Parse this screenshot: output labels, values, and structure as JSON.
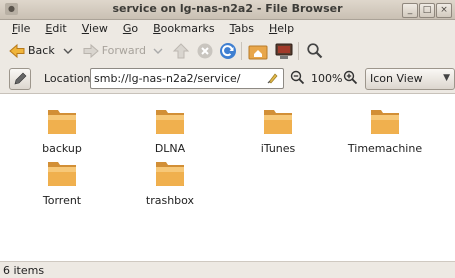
{
  "window": {
    "title": "service on lg-nas-n2a2 - File Browser",
    "controls": [
      "_",
      "□",
      "×"
    ]
  },
  "menu": [
    {
      "label": "File",
      "mnemonic": "F",
      "rest": "ile"
    },
    {
      "label": "Edit",
      "mnemonic": "E",
      "rest": "dit"
    },
    {
      "label": "View",
      "mnemonic": "V",
      "rest": "iew"
    },
    {
      "label": "Go",
      "mnemonic": "G",
      "rest": "o"
    },
    {
      "label": "Bookmarks",
      "mnemonic": "B",
      "rest": "ookmarks"
    },
    {
      "label": "Tabs",
      "mnemonic": "T",
      "rest": "abs"
    },
    {
      "label": "Help",
      "mnemonic": "H",
      "rest": "elp"
    }
  ],
  "toolbar": {
    "back_label": "Back",
    "forward_label": "Forward",
    "icons": [
      "back-arrow-icon",
      "forward-arrow-icon",
      "home-icon",
      "stop-icon",
      "reload-icon",
      "home-folder-icon",
      "computer-icon",
      "search-icon"
    ]
  },
  "location": {
    "label": "Location:",
    "value": "smb://lg-nas-n2a2/service/",
    "zoom": "100%",
    "view_mode": "Icon View"
  },
  "items": [
    {
      "name": "backup"
    },
    {
      "name": "DLNA"
    },
    {
      "name": "iTunes"
    },
    {
      "name": "Timemachine"
    },
    {
      "name": "Torrent"
    },
    {
      "name": "trashbox"
    }
  ],
  "status": {
    "text": "6 items"
  },
  "colors": {
    "folder": "#e8a64a",
    "folder_light": "#f6c97a",
    "accent_blue": "#3f7fd1"
  }
}
